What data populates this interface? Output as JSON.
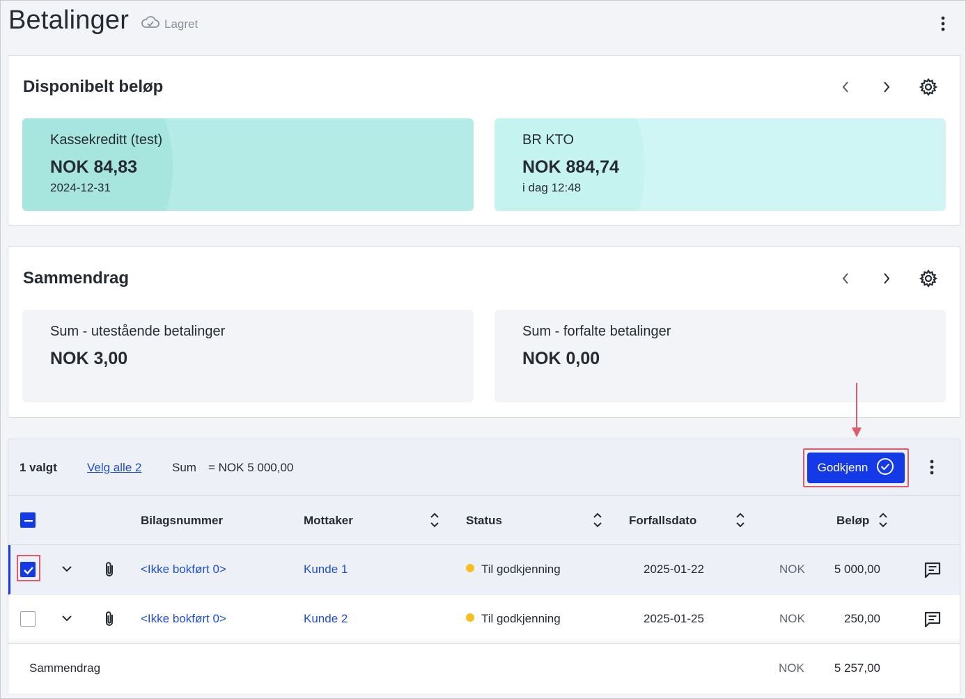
{
  "page": {
    "title": "Betalinger",
    "saved_status": "Lagret"
  },
  "available": {
    "title": "Disponibelt beløp",
    "tiles": [
      {
        "label": "Kassekreditt (test)",
        "amount": "NOK 84,83",
        "date": "2024-12-31",
        "color": "#b4ebe6"
      },
      {
        "label": "BR KTO",
        "amount": "NOK 884,74",
        "date": "i dag 12:48",
        "color": "#cff6f4"
      }
    ]
  },
  "summary": {
    "title": "Sammendrag",
    "tiles": [
      {
        "label": "Sum - utestående betalinger",
        "amount": "NOK 3,00"
      },
      {
        "label": "Sum - forfalte betalinger",
        "amount": "NOK 0,00"
      }
    ]
  },
  "toolbar": {
    "selected_count": "1 valgt",
    "select_all": "Velg alle 2",
    "sum_label": "Sum",
    "sum_value": "= NOK 5 000,00",
    "approve_label": "Godkjenn"
  },
  "table": {
    "headers": {
      "voucher": "Bilagsnummer",
      "recipient": "Mottaker",
      "status": "Status",
      "due": "Forfallsdato",
      "amount": "Beløp"
    },
    "rows": [
      {
        "selected": true,
        "voucher": "<Ikke bokført 0>",
        "recipient": "Kunde 1",
        "status": "Til godkjenning",
        "due": "2025-01-22",
        "currency": "NOK",
        "amount": "5 000,00"
      },
      {
        "selected": false,
        "voucher": "<Ikke bokført 0>",
        "recipient": "Kunde 2",
        "status": "Til godkjenning",
        "due": "2025-01-25",
        "currency": "NOK",
        "amount": "250,00"
      }
    ],
    "footer": {
      "label": "Sammendrag",
      "currency": "NOK",
      "total": "5 257,00"
    }
  },
  "colors": {
    "accent": "#1439e6",
    "link": "#1f4fd1",
    "status_pending": "#f6be1f",
    "highlight": "#e05a6a"
  }
}
